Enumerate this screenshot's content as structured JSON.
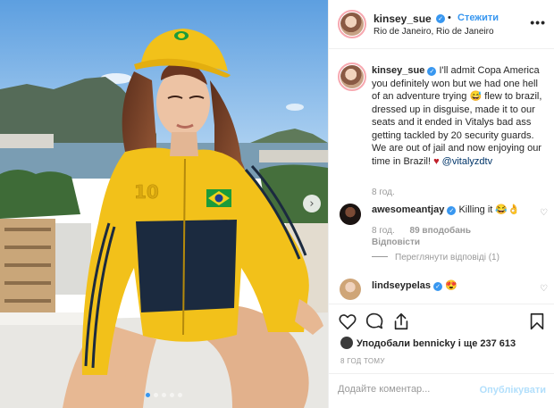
{
  "post": {
    "username": "kinsey_sue",
    "follow_label": "Стежити",
    "location": "Rio de Janeiro, Rio de Janeiro",
    "more_label": "•••"
  },
  "caption": {
    "username": "kinsey_sue",
    "text": "I'll admit Copa America you definitely won but we had one hell of an adventure trying 😅 flew to brazil, dressed up in disguise, made it to our seats and it ended in Vitalys bad ass getting tackled by 20 security guards. We are out of jail and now enjoying our time in Brazil! ",
    "heart": "♥",
    "mention": "@vitalyzdtv",
    "time": "8 год."
  },
  "comments": [
    {
      "username": "awesomeantjay",
      "text": "Killing it 😂👌",
      "time": "8 год.",
      "likes": "89 вподобань",
      "reply": "Відповісти",
      "view_replies": "Переглянути відповіді (1)"
    },
    {
      "username": "lindseypelas",
      "text": "😍"
    }
  ],
  "likes_text": "Уподобали bennicky і ще 237 613",
  "likes_user": "bennicky",
  "likes_count": "237 613",
  "post_time": "8 ГОД ТОМУ",
  "comment_box": {
    "placeholder": "Додайте коментар...",
    "publish": "Опублікувати"
  },
  "icons": [
    "heart-icon",
    "comment-icon",
    "share-icon",
    "bookmark-icon",
    "verified-icon",
    "next-arrow-icon"
  ],
  "colors": {
    "link": "#3897f0",
    "mention": "#003569",
    "muted": "#999999",
    "jacket": "#f2c11a",
    "jacket_dark": "#1b2a3f",
    "sky": "#7eb5e6"
  },
  "carousel": {
    "total": 5,
    "active": 1
  }
}
